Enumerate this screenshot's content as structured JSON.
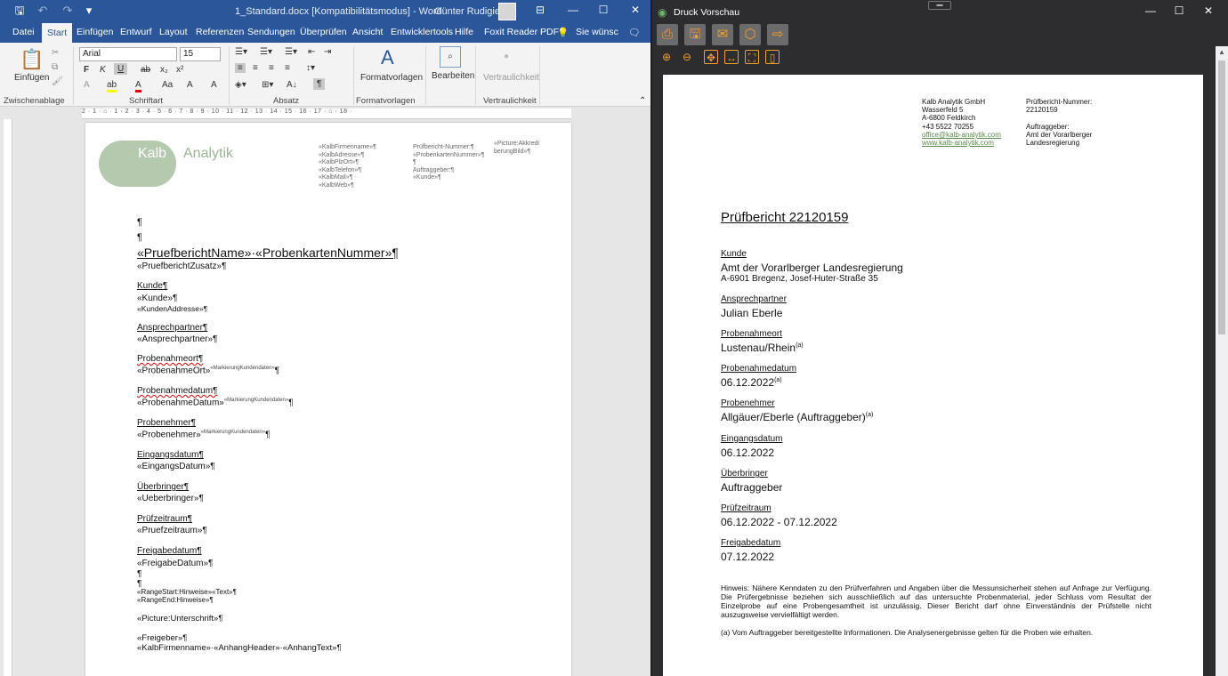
{
  "word": {
    "title": "1_Standard.docx [Kompatibilitätsmodus] - Word",
    "user": "Günter Rudigier",
    "tabs": [
      "Datei",
      "Start",
      "Einfügen",
      "Entwurf",
      "Layout",
      "Referenzen",
      "Sendungen",
      "Überprüfen",
      "Ansicht",
      "Entwicklertools",
      "Hilfe",
      "Foxit Reader PDF",
      "Sie wünsc"
    ],
    "ribbon": {
      "paste_label": "Einfügen",
      "font_name": "Arial",
      "font_size": "15",
      "formatvorlagen": "Formatvorlagen",
      "bearbeiten": "Bearbeiten",
      "vertraulichkeit": "Vertraulichkeit",
      "groups": [
        "Zwischenablage",
        "Schriftart",
        "Absatz",
        "Formatvorlagen",
        "Vertraulichkeit"
      ]
    },
    "ruler": "2 · 1 · ⌂ · 1 · 2 · 3 · 4 · 5 · 6 · 7 · 8 · 9 · 10 · 11 · 12 · 13 · 14 · 15 · 16 · 17 · ⌂ · 18 ·",
    "doc": {
      "logo_word1": "Kalb",
      "logo_word2": "Analytik",
      "merge_col1": "«KalbFirmenname»¶\n«KalbAdresse»¶\n«KalbPlzOrt»¶\n«KalbTelefon»¶\n«KalbMail»¶\n«KalbWeb»¶",
      "merge_col2": "Prüfbericht-Nummer:¶\n«ProbenkartenNummer»¶\n¶\nAuftraggeber:¶\n«Kunde»¶",
      "merge_col3": "«Picture:Akkredi\nberungBild»¶",
      "para1": "¶",
      "para2": "¶",
      "heading": "«PruefberichtName»·«ProbenkartenNummer»¶",
      "zusatz": "«PruefberichtZusatz»¶",
      "kunde_l": "Kunde¶",
      "kunde_v": "«Kunde»¶",
      "kunden_adr": "«KundenAddresse»¶",
      "ansp_l": "Ansprechpartner¶",
      "ansp_v": "«Ansprechpartner»¶",
      "ort_l": "Probenahmeort¶",
      "ort_v": "«ProbenahmeOrt»",
      "datum_l": "Probenahmedatum¶",
      "datum_v": "«ProbenahmeDatum»",
      "nehmer_l": "Probenehmer¶",
      "nehmer_v": "«Probenehmer»",
      "sup": "«MarkierungKundendaten»",
      "pil": "¶",
      "eing_l": "Eingangsdatum¶",
      "eing_v": "«EingangsDatum»¶",
      "ueb_l": "Überbringer¶",
      "ueb_v": "«Ueberbringer»¶",
      "pz_l": "Prüfzeitraum¶",
      "pz_v": "«Pruefzeitraum»¶",
      "fg_l": "Freigabedatum¶",
      "fg_v": "«FreigabeDatum»¶",
      "p3": "¶",
      "p4": "¶",
      "range1": "«RangeStart:Hinweise»«Text»¶",
      "range2": "«RangeEnd:Hinweise»¶",
      "picture": "«Picture:Unterschrift»¶",
      "freigeber": "«Freigeber»¶",
      "last": "«KalbFirmenname»·«AnhangHeader»·«AnhangText»¶"
    }
  },
  "preview": {
    "title": "Druck Vorschau",
    "header": {
      "company": "Kalb Analytik GmbH",
      "street": "Wasserfeld 5",
      "city": "A-6800 Feldkirch",
      "phone": "+43 5522 70255",
      "mail": "office@kalb-analytik.com",
      "web": "www.kalb-analytik.com",
      "nr_label": "Prüfbericht-Nummer:",
      "nr": "22120159",
      "ag_label": "Auftraggeber:",
      "ag1": "Amt der Vorarlberger",
      "ag2": "Landesregierung"
    },
    "title_text": "Prüfbericht 22120159",
    "kunde_l": "Kunde",
    "kunde_v": "Amt der Vorarlberger Landesregierung",
    "kunde_adr": "A-6901 Bregenz, Josef-Huter-Straße 35",
    "ansp_l": "Ansprechpartner",
    "ansp_v": "Julian Eberle",
    "ort_l": "Probenahmeort",
    "ort_v": "Lustenau/Rhein",
    "datum_l": "Probenahmedatum",
    "datum_v": "06.12.2022",
    "nehmer_l": "Probenehmer",
    "nehmer_v": "Allgäuer/Eberle (Auftraggeber)",
    "mark": "(a)",
    "eing_l": "Eingangsdatum",
    "eing_v": "06.12.2022",
    "ueb_l": "Überbringer",
    "ueb_v": "Auftraggeber",
    "pz_l": "Prüfzeitraum",
    "pz_v": "06.12.2022 - 07.12.2022",
    "fg_l": "Freigabedatum",
    "fg_v": "07.12.2022",
    "note": "Hinweis: Nähere Kenndaten zu den Prüfverfahren und Angaben über die Messunsicherheit stehen auf Anfrage zur Verfügung. Die Prüfergebnisse beziehen sich ausschließlich auf das untersuchte Probenmaterial, jeder Schluss vom Resultat der Einzelprobe auf eine Probengesamtheit ist unzulässig. Dieser Bericht darf ohne Einverständnis der Prüfstelle nicht auszugsweise vervielfältigt werden.",
    "footnote": "(a) Vom Auftraggeber bereitgestellte Informationen. Die Analysenergebnisse gelten für die Proben wie erhalten."
  }
}
